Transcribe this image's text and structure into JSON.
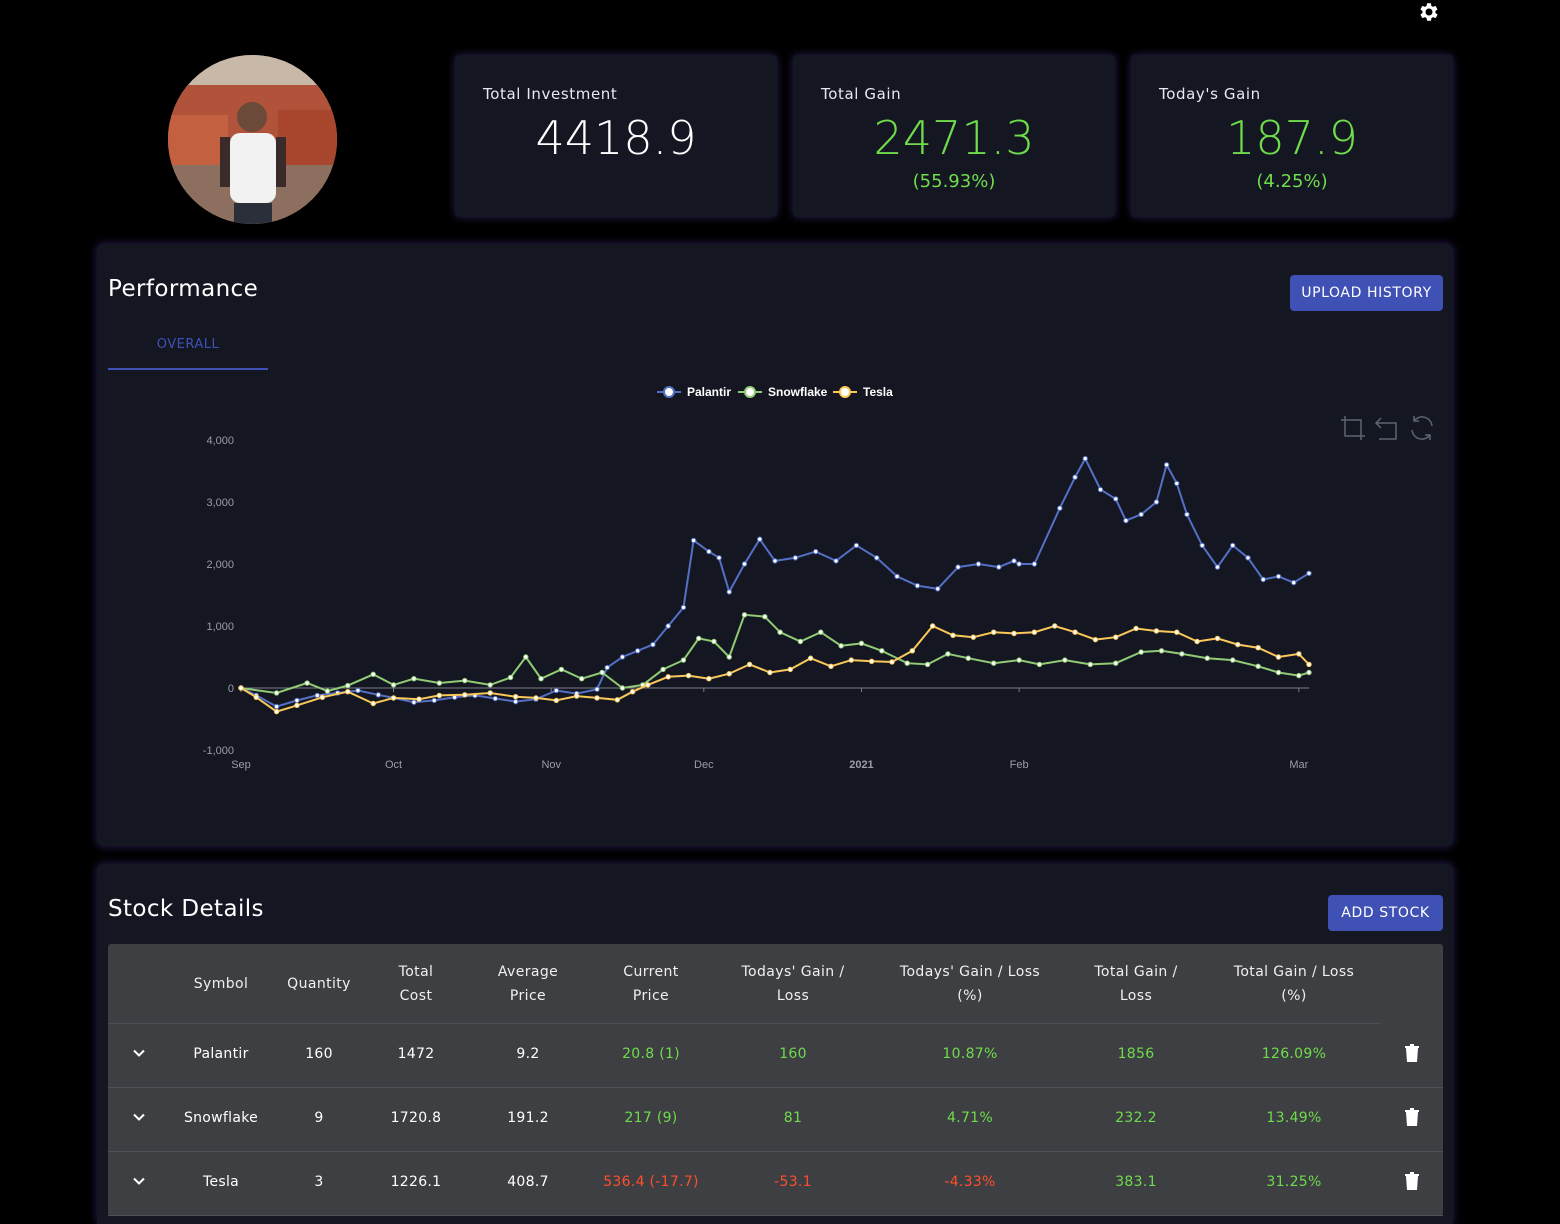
{
  "header": {
    "settings_icon": "gear-icon"
  },
  "profile": {
    "avatar_alt": "User avatar"
  },
  "cards": [
    {
      "label": "Total Investment",
      "value": "4418.9",
      "pct": ""
    },
    {
      "label": "Total Gain",
      "value": "2471.3",
      "pct": "(55.93%)"
    },
    {
      "label": "Today's Gain",
      "value": "187.9",
      "pct": "(4.25%)"
    }
  ],
  "performance": {
    "title": "Performance",
    "upload_label": "UPLOAD HISTORY",
    "tab_label": "OVERALL",
    "toolbox": [
      "zoom-icon",
      "zoom-reset-icon",
      "restore-icon"
    ]
  },
  "colors": {
    "palantir": "#5470c6",
    "snowflake": "#91cc75",
    "tesla": "#fac858",
    "green": "#6fdc4b",
    "red": "#ff4e2b",
    "accent": "#3f51b5"
  },
  "chart_data": {
    "type": "line",
    "x_ticks": [
      "Sep",
      "Oct",
      "Nov",
      "Dec",
      "2021",
      "Feb",
      "Mar"
    ],
    "y_ticks": [
      "4,000",
      "3,000",
      "2,000",
      "1,000",
      "0",
      "-1,000"
    ],
    "ylim": [
      -1000,
      4000
    ],
    "x_range": [
      "2020-09-01",
      "2021-03-05"
    ],
    "legend_position": "top-center",
    "series": [
      {
        "name": "Palantir",
        "color": "#5470c6",
        "points": [
          [
            "2020-09-01",
            0
          ],
          [
            "2020-09-04",
            -120
          ],
          [
            "2020-09-08",
            -300
          ],
          [
            "2020-09-12",
            -200
          ],
          [
            "2020-09-16",
            -120
          ],
          [
            "2020-09-20",
            -80
          ],
          [
            "2020-09-24",
            -40
          ],
          [
            "2020-09-28",
            -110
          ],
          [
            "2020-10-01",
            -160
          ],
          [
            "2020-10-05",
            -230
          ],
          [
            "2020-10-09",
            -200
          ],
          [
            "2020-10-13",
            -150
          ],
          [
            "2020-10-17",
            -120
          ],
          [
            "2020-10-21",
            -170
          ],
          [
            "2020-10-25",
            -220
          ],
          [
            "2020-10-29",
            -180
          ],
          [
            "2020-11-02",
            -40
          ],
          [
            "2020-11-06",
            -90
          ],
          [
            "2020-11-10",
            -20
          ],
          [
            "2020-11-12",
            330
          ],
          [
            "2020-11-15",
            500
          ],
          [
            "2020-11-18",
            600
          ],
          [
            "2020-11-21",
            700
          ],
          [
            "2020-11-24",
            1000
          ],
          [
            "2020-11-27",
            1300
          ],
          [
            "2020-11-29",
            2380
          ],
          [
            "2020-12-02",
            2200
          ],
          [
            "2020-12-04",
            2100
          ],
          [
            "2020-12-06",
            1550
          ],
          [
            "2020-12-09",
            2000
          ],
          [
            "2020-12-12",
            2400
          ],
          [
            "2020-12-15",
            2050
          ],
          [
            "2020-12-19",
            2100
          ],
          [
            "2020-12-23",
            2200
          ],
          [
            "2020-12-27",
            2050
          ],
          [
            "2020-12-31",
            2300
          ],
          [
            "2021-01-04",
            2100
          ],
          [
            "2021-01-08",
            1800
          ],
          [
            "2021-01-12",
            1650
          ],
          [
            "2021-01-16",
            1600
          ],
          [
            "2021-01-20",
            1950
          ],
          [
            "2021-01-24",
            2000
          ],
          [
            "2021-01-28",
            1950
          ],
          [
            "2021-02-01",
            2000
          ],
          [
            "2021-01-31",
            2050
          ],
          [
            "2021-02-04",
            2000
          ],
          [
            "2021-02-09",
            2900
          ],
          [
            "2021-02-12",
            3400
          ],
          [
            "2021-02-14",
            3700
          ],
          [
            "2021-02-17",
            3200
          ],
          [
            "2021-02-20",
            3050
          ],
          [
            "2021-02-22",
            2700
          ],
          [
            "2021-02-25",
            2800
          ],
          [
            "2021-02-28",
            3000
          ],
          [
            "2021-03-02",
            3600
          ],
          [
            "2021-03-04",
            3300
          ],
          [
            "2021-03-06",
            2800
          ],
          [
            "2021-03-09",
            2300
          ],
          [
            "2021-03-12",
            1950
          ],
          [
            "2021-03-15",
            2300
          ],
          [
            "2021-03-18",
            2100
          ],
          [
            "2021-03-21",
            1750
          ],
          [
            "2021-03-24",
            1800
          ],
          [
            "2021-03-27",
            1700
          ],
          [
            "2021-03-30",
            1850
          ]
        ]
      },
      {
        "name": "Snowflake",
        "color": "#91cc75",
        "points": [
          [
            "2020-09-01",
            0
          ],
          [
            "2020-09-08",
            -80
          ],
          [
            "2020-09-14",
            80
          ],
          [
            "2020-09-18",
            -50
          ],
          [
            "2020-09-22",
            40
          ],
          [
            "2020-09-27",
            220
          ],
          [
            "2020-10-01",
            50
          ],
          [
            "2020-10-05",
            150
          ],
          [
            "2020-10-10",
            80
          ],
          [
            "2020-10-15",
            120
          ],
          [
            "2020-10-20",
            50
          ],
          [
            "2020-10-24",
            170
          ],
          [
            "2020-10-27",
            500
          ],
          [
            "2020-10-30",
            150
          ],
          [
            "2020-11-03",
            300
          ],
          [
            "2020-11-07",
            150
          ],
          [
            "2020-11-11",
            250
          ],
          [
            "2020-11-15",
            0
          ],
          [
            "2020-11-19",
            50
          ],
          [
            "2020-11-23",
            300
          ],
          [
            "2020-11-27",
            450
          ],
          [
            "2020-11-30",
            800
          ],
          [
            "2020-12-03",
            750
          ],
          [
            "2020-12-06",
            500
          ],
          [
            "2020-12-09",
            1180
          ],
          [
            "2020-12-13",
            1150
          ],
          [
            "2020-12-16",
            900
          ],
          [
            "2020-12-20",
            750
          ],
          [
            "2020-12-24",
            900
          ],
          [
            "2020-12-28",
            680
          ],
          [
            "2021-01-01",
            720
          ],
          [
            "2021-01-05",
            600
          ],
          [
            "2021-01-10",
            400
          ],
          [
            "2021-01-14",
            380
          ],
          [
            "2021-01-18",
            550
          ],
          [
            "2021-01-22",
            480
          ],
          [
            "2021-01-27",
            400
          ],
          [
            "2021-02-01",
            450
          ],
          [
            "2021-02-05",
            380
          ],
          [
            "2021-02-10",
            450
          ],
          [
            "2021-02-15",
            380
          ],
          [
            "2021-02-20",
            400
          ],
          [
            "2021-02-25",
            580
          ],
          [
            "2021-03-01",
            600
          ],
          [
            "2021-03-05",
            550
          ],
          [
            "2021-03-10",
            480
          ],
          [
            "2021-03-15",
            450
          ],
          [
            "2021-03-20",
            350
          ],
          [
            "2021-03-24",
            250
          ],
          [
            "2021-03-28",
            200
          ],
          [
            "2021-03-30",
            250
          ]
        ]
      },
      {
        "name": "Tesla",
        "color": "#fac858",
        "points": [
          [
            "2020-09-01",
            0
          ],
          [
            "2020-09-04",
            -150
          ],
          [
            "2020-09-08",
            -380
          ],
          [
            "2020-09-12",
            -280
          ],
          [
            "2020-09-17",
            -150
          ],
          [
            "2020-09-22",
            -60
          ],
          [
            "2020-09-27",
            -250
          ],
          [
            "2020-10-01",
            -160
          ],
          [
            "2020-10-06",
            -180
          ],
          [
            "2020-10-10",
            -120
          ],
          [
            "2020-10-15",
            -110
          ],
          [
            "2020-10-20",
            -80
          ],
          [
            "2020-10-25",
            -140
          ],
          [
            "2020-10-29",
            -160
          ],
          [
            "2020-11-02",
            -200
          ],
          [
            "2020-11-06",
            -130
          ],
          [
            "2020-11-10",
            -160
          ],
          [
            "2020-11-14",
            -190
          ],
          [
            "2020-11-17",
            -60
          ],
          [
            "2020-11-20",
            50
          ],
          [
            "2020-11-24",
            180
          ],
          [
            "2020-11-28",
            200
          ],
          [
            "2020-12-02",
            150
          ],
          [
            "2020-12-06",
            230
          ],
          [
            "2020-12-10",
            380
          ],
          [
            "2020-12-14",
            250
          ],
          [
            "2020-12-18",
            300
          ],
          [
            "2020-12-22",
            480
          ],
          [
            "2020-12-26",
            350
          ],
          [
            "2020-12-30",
            450
          ],
          [
            "2021-01-03",
            430
          ],
          [
            "2021-01-07",
            420
          ],
          [
            "2021-01-11",
            600
          ],
          [
            "2021-01-15",
            1000
          ],
          [
            "2021-01-19",
            850
          ],
          [
            "2021-01-23",
            820
          ],
          [
            "2021-01-27",
            900
          ],
          [
            "2021-01-31",
            880
          ],
          [
            "2021-02-04",
            900
          ],
          [
            "2021-02-08",
            1000
          ],
          [
            "2021-02-12",
            900
          ],
          [
            "2021-02-16",
            780
          ],
          [
            "2021-02-20",
            820
          ],
          [
            "2021-02-24",
            960
          ],
          [
            "2021-02-28",
            920
          ],
          [
            "2021-03-04",
            900
          ],
          [
            "2021-03-08",
            750
          ],
          [
            "2021-03-12",
            800
          ],
          [
            "2021-03-16",
            700
          ],
          [
            "2021-03-20",
            650
          ],
          [
            "2021-03-24",
            500
          ],
          [
            "2021-03-28",
            550
          ],
          [
            "2021-03-30",
            380
          ]
        ]
      }
    ]
  },
  "stock_details": {
    "title": "Stock Details",
    "add_label": "ADD STOCK",
    "headers": [
      "Symbol",
      "Quantity",
      "Total\nCost",
      "Average\nPrice",
      "Current\nPrice",
      "Todays' Gain /\nLoss",
      "Todays' Gain / Loss\n(%)",
      "Total Gain /\nLoss",
      "Total Gain / Loss\n(%)"
    ],
    "rows": [
      {
        "symbol": "Palantir",
        "quantity": "160",
        "total_cost": "1472",
        "avg_price": "9.2",
        "current_price": "20.8 (1)",
        "todays_gain": "160",
        "todays_gain_pct": "10.87%",
        "total_gain": "1856",
        "total_gain_pct": "126.09%",
        "today_status": "green",
        "total_status": "green"
      },
      {
        "symbol": "Snowflake",
        "quantity": "9",
        "total_cost": "1720.8",
        "avg_price": "191.2",
        "current_price": "217 (9)",
        "todays_gain": "81",
        "todays_gain_pct": "4.71%",
        "total_gain": "232.2",
        "total_gain_pct": "13.49%",
        "today_status": "green",
        "total_status": "green"
      },
      {
        "symbol": "Tesla",
        "quantity": "3",
        "total_cost": "1226.1",
        "avg_price": "408.7",
        "current_price": "536.4 (-17.7)",
        "todays_gain": "-53.1",
        "todays_gain_pct": "-4.33%",
        "total_gain": "383.1",
        "total_gain_pct": "31.25%",
        "today_status": "red",
        "total_status": "green"
      }
    ]
  }
}
